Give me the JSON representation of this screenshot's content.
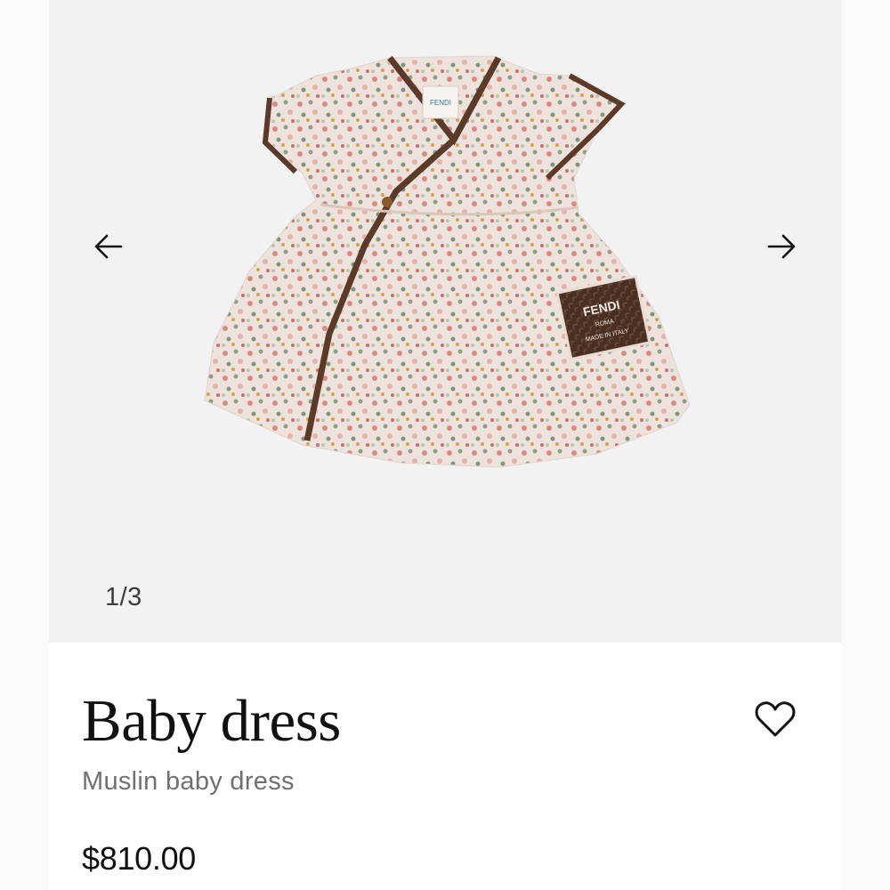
{
  "gallery": {
    "counter": "1/3",
    "prev_icon": "arrow-left-icon",
    "next_icon": "arrow-right-icon",
    "image": {
      "label_tag": "FENDI",
      "patch": {
        "brand": "FENDI",
        "city": "ROMA",
        "made_in": "MADE IN ITALY"
      }
    }
  },
  "product": {
    "title": "Baby dress",
    "subtitle": "Muslin baby dress",
    "price": "$810.00",
    "wishlist_icon": "heart-icon"
  },
  "colors": {
    "fabric": "#e9dcd3",
    "trim": "#5b3a2a",
    "patch": "#4a3024",
    "text_primary": "#111111",
    "text_secondary": "#707070"
  }
}
